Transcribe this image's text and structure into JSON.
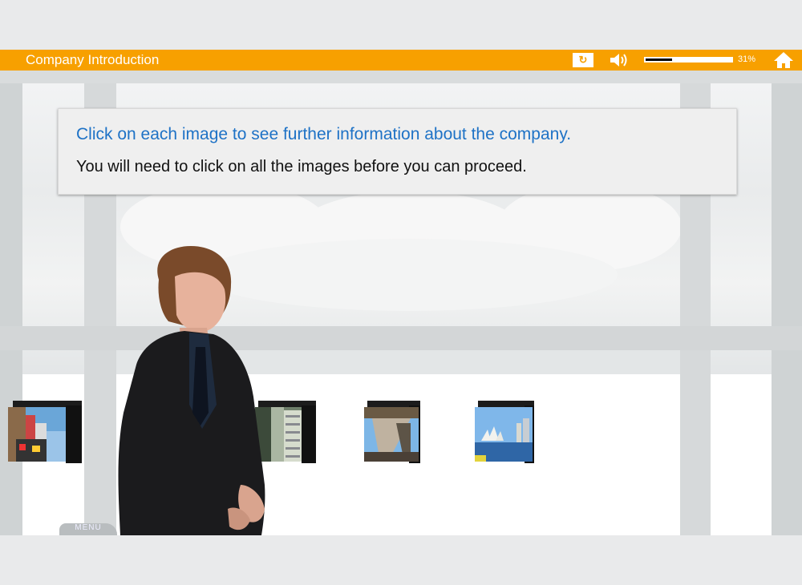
{
  "header": {
    "title": "Company Introduction",
    "replay_icon": "replay-icon",
    "volume_icon": "speaker-volume-icon",
    "progress_percent": 31,
    "progress_label": "31%",
    "home_icon": "home-icon"
  },
  "instructions": {
    "line1": "Click on each image to see further information about the company.",
    "line2": "You will need to click on all the images before you can proceed."
  },
  "image_cubes": [
    {
      "name": "city-street-image"
    },
    {
      "name": "skyscrapers-image"
    },
    {
      "name": "bridge-image"
    },
    {
      "name": "sydney-opera-house-image"
    }
  ],
  "menu": {
    "label": "MENU"
  },
  "colors": {
    "accent": "#f7a000",
    "instruction_blue": "#1e72c6"
  }
}
